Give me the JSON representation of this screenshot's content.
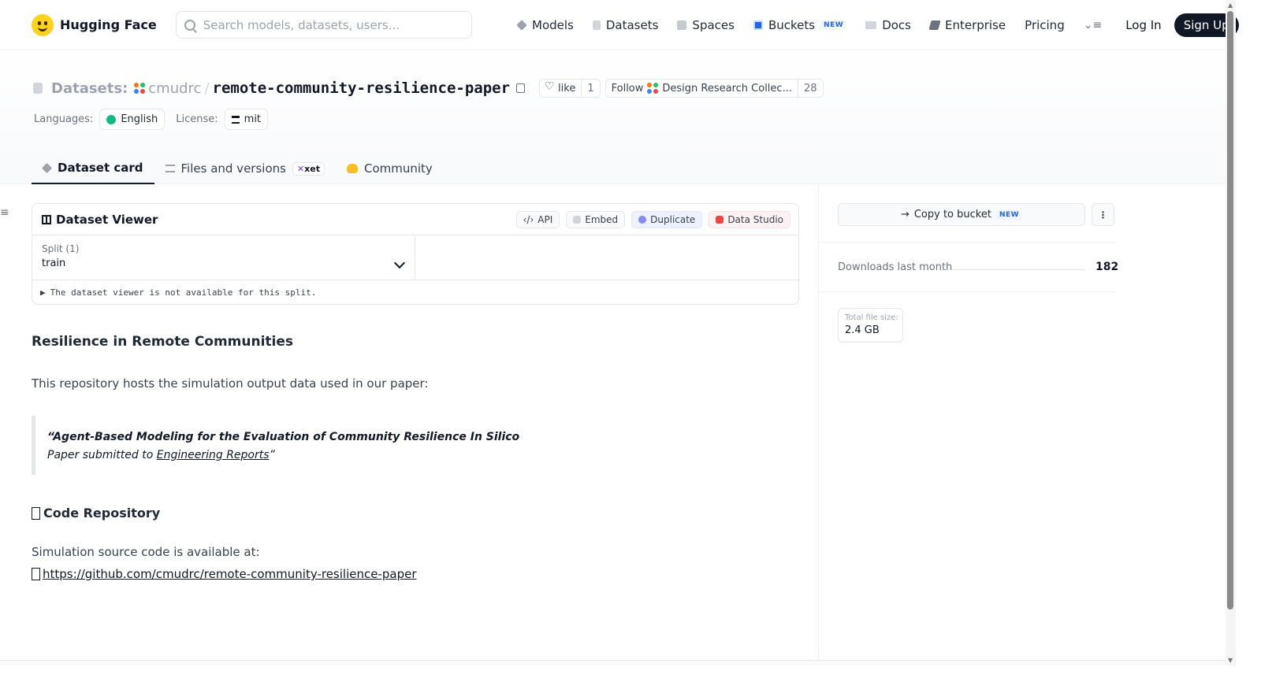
{
  "nav": {
    "brand": "Hugging Face",
    "search_placeholder": "Search models, datasets, users...",
    "links": [
      {
        "label": "Models",
        "icon": "cube-icon"
      },
      {
        "label": "Datasets",
        "icon": "database-icon"
      },
      {
        "label": "Spaces",
        "icon": "grid-icon"
      },
      {
        "label": "Buckets",
        "icon": "bucket-icon",
        "badge": "NEW"
      },
      {
        "label": "Docs",
        "icon": "book-icon"
      },
      {
        "label": "Enterprise",
        "icon": "building-icon"
      },
      {
        "label": "Pricing"
      }
    ],
    "login": "Log In",
    "signup": "Sign Up"
  },
  "header": {
    "prefix": "Datasets:",
    "org": "cmudrc",
    "separator": "/",
    "repo": "remote-community-resilience-paper",
    "like_label": "like",
    "like_count": "1",
    "follow_label": "Follow",
    "follow_org": "Design Research Collec...",
    "follow_count": "28",
    "languages_label": "Languages:",
    "language": "English",
    "license_label": "License:",
    "license": "mit"
  },
  "tabs": [
    {
      "label": "Dataset card",
      "active": true
    },
    {
      "label": "Files and versions",
      "badge": "xet"
    },
    {
      "label": "Community"
    }
  ],
  "viewer": {
    "title": "Dataset Viewer",
    "buttons": [
      "API",
      "Embed",
      "Duplicate",
      "Data Studio"
    ],
    "split_label": "Split (1)",
    "split_value": "train",
    "not_available": "The dataset viewer is not available for this split."
  },
  "card": {
    "title": "Resilience in Remote Communities",
    "intro": "This repository hosts the simulation output data used in our paper:",
    "quote_title": "“Agent-Based Modeling for the Evaluation of Community Resilience In Silico",
    "quote_sub_prefix": "Paper submitted to ",
    "quote_sub_link": "Engineering Reports",
    "quote_sub_suffix": "”",
    "code_heading": "Code Repository",
    "code_intro": "Simulation source code is available at:",
    "code_link": "https://github.com/cmudrc/remote-community-resilience-paper"
  },
  "sidebar": {
    "copy_bucket": "Copy to bucket",
    "copy_badge": "NEW",
    "downloads_label": "Downloads last month",
    "downloads_value": "182",
    "size_label": "Total file size:",
    "size_value": "2.4 GB"
  },
  "colors": {
    "accent_dark": "#111827",
    "new_badge": "#2563eb",
    "brand_yellow": "#ffd21e"
  }
}
